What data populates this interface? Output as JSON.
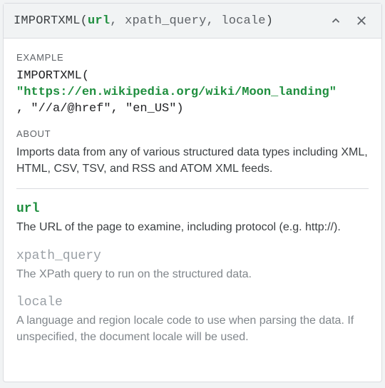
{
  "header": {
    "fn": "IMPORTXML",
    "open": "(",
    "arg_url": "url",
    "sep1": ", ",
    "arg_xpath": "xpath_query",
    "sep2": ", ",
    "arg_locale": "locale",
    "close": ")"
  },
  "example": {
    "title": "EXAMPLE",
    "fn": "IMPORTXML(",
    "url_open_quote": "\"",
    "url_value": "https://en.wikipedia.org/wiki/Moon_landing",
    "url_close_quote": "\"",
    "rest": ", \"//a/@href\", \"en_US\")"
  },
  "about": {
    "title": "ABOUT",
    "text": "Imports data from any of various structured data types including XML, HTML, CSV, TSV, and RSS and ATOM XML feeds."
  },
  "params": [
    {
      "name": "url",
      "required": true,
      "desc": "The URL of the page to examine, including protocol (e.g. http://)."
    },
    {
      "name": "xpath_query",
      "required": false,
      "desc": "The XPath query to run on the structured data."
    },
    {
      "name": "locale",
      "required": false,
      "desc": "A language and region locale code to use when parsing the data. If unspecified, the document locale will be used."
    }
  ]
}
